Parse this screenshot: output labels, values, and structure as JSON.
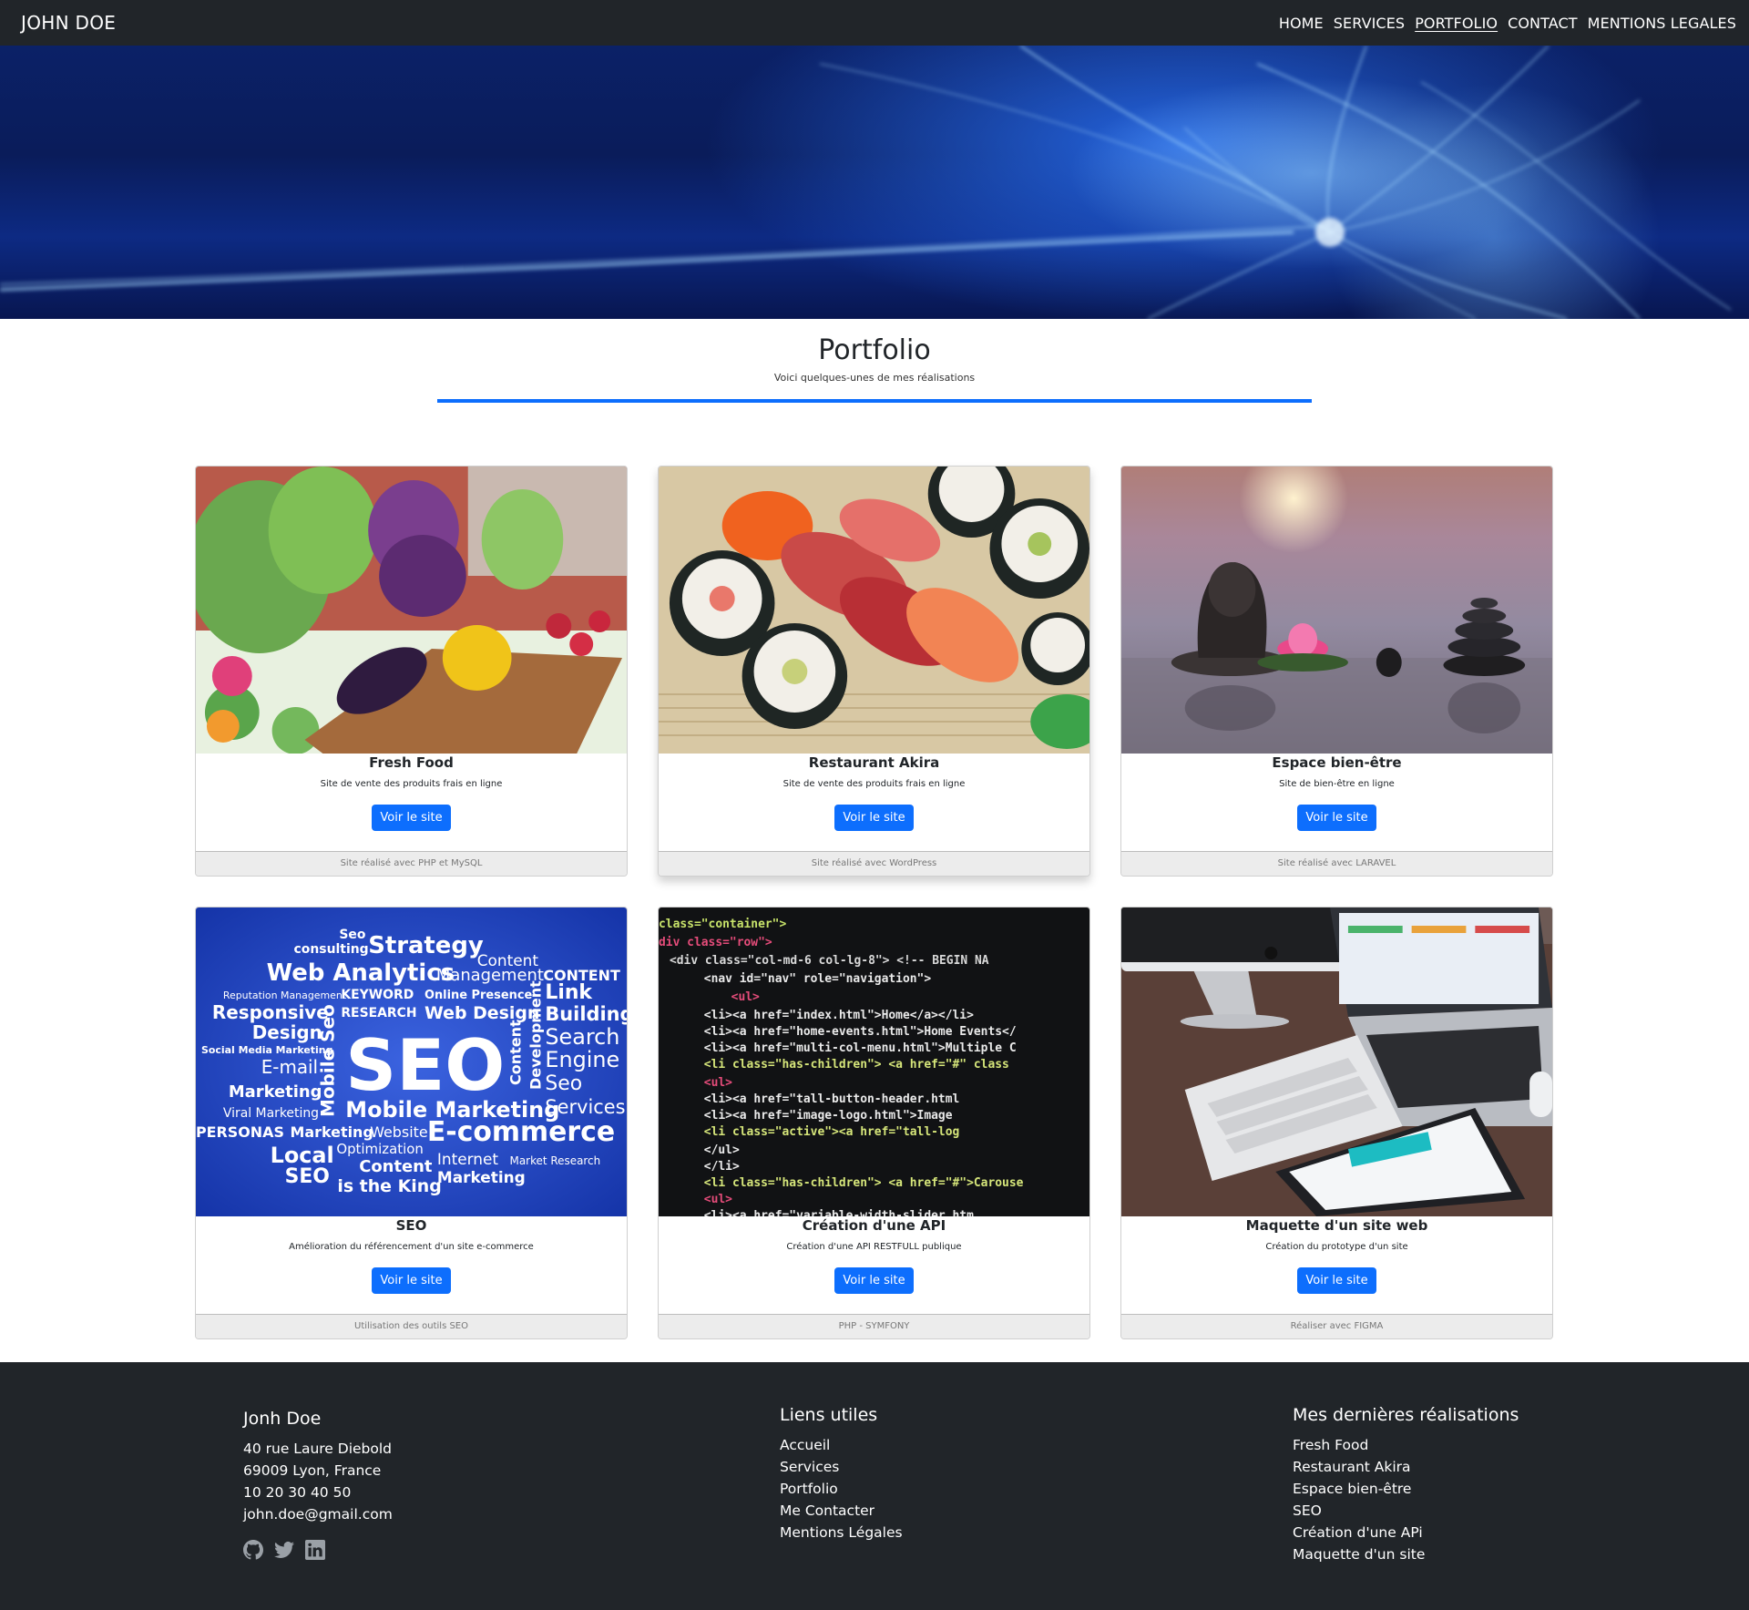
{
  "navbar": {
    "brand": "JOHN DOE",
    "links": [
      "HOME",
      "SERVICES",
      "PORTFOLIO",
      "CONTACT",
      "MENTIONS LEGALES"
    ]
  },
  "section": {
    "title": "Portfolio",
    "subtitle": "Voici quelques-unes de mes réalisations",
    "accent_color": "#0d6efd"
  },
  "cards": [
    {
      "title": "Fresh Food",
      "text": "Site de vente des produits frais en ligne",
      "button": "Voir le site",
      "footer": "Site réalisé avec PHP et MySQL",
      "image": "vegetables-photo"
    },
    {
      "title": "Restaurant Akira",
      "text": "Site de vente des produits frais en ligne",
      "button": "Voir le site",
      "footer": "Site réalisé avec WordPress",
      "image": "sushi-photo"
    },
    {
      "title": "Espace bien-être",
      "text": "Site de bien-être en ligne",
      "button": "Voir le site",
      "footer": "Site réalisé avec LARAVEL",
      "image": "zen-stones-photo"
    },
    {
      "title": "SEO",
      "text": "Amélioration du référencement d'un site e-commerce",
      "button": "Voir le site",
      "footer": "Utilisation des outils SEO",
      "image": "seo-word-cloud"
    },
    {
      "title": "Création d'une API",
      "text": "Création d'une API RESTFULL publique",
      "button": "Voir le site",
      "footer": "PHP - SYMFONY",
      "image": "code-screen-photo"
    },
    {
      "title": "Maquette d'un site web",
      "text": "Création du prototype d'un site",
      "button": "Voir le site",
      "footer": "Réaliser avec FIGMA",
      "image": "desk-devices-photo"
    }
  ],
  "seo_words": [
    "Seo",
    "consulting",
    "Strategy",
    "Content",
    "Web Analytics",
    "Management",
    "CONTENT",
    "Reputation Management",
    "KEYWORD",
    "Online Presence",
    "Link",
    "Responsive",
    "RESEARCH",
    "Web Design",
    "Building",
    "Design",
    "Search",
    "Social Media Marketing",
    "Engine",
    "E-mail",
    "SEO",
    "Content",
    "Development",
    "Mobile Seo",
    "Seo",
    "Marketing",
    "Services",
    "Viral Marketing",
    "Mobile Marketing",
    "Website",
    "PERSONAS",
    "Marketing",
    "E-commerce",
    "Local",
    "Optimization",
    "Internet",
    "Market Research",
    "SEO",
    "Content",
    "Marketing",
    "is the King"
  ],
  "code_lines": [
    "class=\"container\">",
    "div class=\"row\">",
    "  <div class=\"col-md-6 col-lg-8\"> <!--        BEGIN NA",
    "    <nav id=\"nav\" role=\"navigation\">",
    "      <ul>",
    "        <li><a href=\"index.html\">Home</a></li>",
    "        <li><a href=\"home-events.html\">Home Events</",
    "        <li><a href=\"multi-col-menu.html\">Multiple C",
    "        <li class=\"has-children\"> <a href=\"#\" class",
    "          <ul>",
    "            <li><a href=\"tall-button-header.html",
    "            <li><a href=\"image-logo.html\">Image",
    "            <li class=\"active\"><a href=\"tall-log",
    "          </ul>",
    "        </li>",
    "        <li class=\"has-children\"> <a href=\"#\">Carouse",
    "          <ul>",
    "            <li><a href=\"variable-width-slider.htm"
  ],
  "footer": {
    "contact": {
      "name": "Jonh Doe",
      "address1": "40 rue Laure Diebold",
      "address2": "69009 Lyon, France",
      "phone": "10 20 30 40 50",
      "email": "john.doe@gmail.com",
      "social_icons": [
        "github-icon",
        "twitter-icon",
        "linkedin-icon"
      ]
    },
    "links": {
      "title": "Liens utiles",
      "items": [
        "Accueil",
        "Services",
        "Portfolio",
        "Me Contacter",
        "Mentions Légales"
      ]
    },
    "recent": {
      "title": "Mes dernières réalisations",
      "items": [
        "Fresh Food",
        "Restaurant Akira",
        "Espace bien-être",
        "SEO",
        "Création d'une APi",
        "Maquette d'un site"
      ]
    }
  }
}
